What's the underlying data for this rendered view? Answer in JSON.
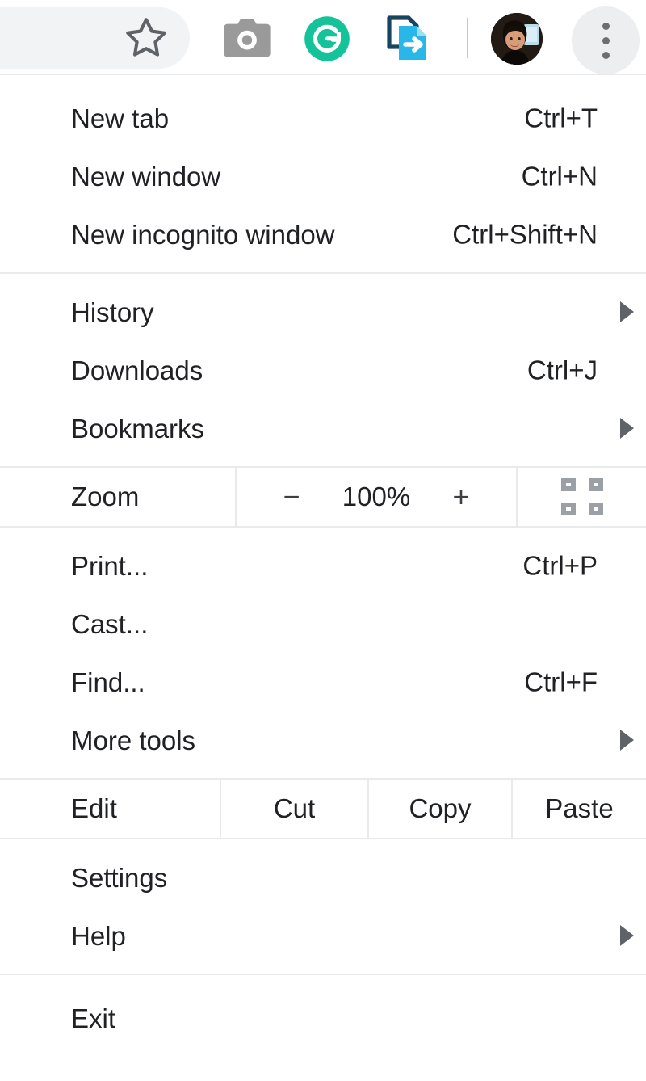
{
  "toolbar": {
    "bookmark_icon": "star-icon",
    "screenshot_icon": "camera-icon",
    "grammarly_icon": "grammarly-g-icon",
    "send_document_icon": "document-send-icon",
    "avatar_label": "profile-avatar",
    "menu_icon": "three-dot-menu-icon",
    "colors": {
      "omnibox_bg": "#f1f3f4",
      "grammarly_green": "#15c39a",
      "doc_cyan": "#29b6e8",
      "doc_navy": "#1b4965",
      "menu_btn_bg": "#eceef0"
    }
  },
  "menu": {
    "groups": [
      {
        "items": [
          {
            "label": "New tab",
            "shortcut": "Ctrl+T",
            "arrow": false
          },
          {
            "label": "New window",
            "shortcut": "Ctrl+N",
            "arrow": false
          },
          {
            "label": "New incognito window",
            "shortcut": "Ctrl+Shift+N",
            "arrow": false
          }
        ]
      },
      {
        "items": [
          {
            "label": "History",
            "shortcut": "",
            "arrow": true
          },
          {
            "label": "Downloads",
            "shortcut": "Ctrl+J",
            "arrow": false
          },
          {
            "label": "Bookmarks",
            "shortcut": "",
            "arrow": true
          }
        ]
      },
      {
        "items": [
          {
            "label": "Print...",
            "shortcut": "Ctrl+P",
            "arrow": false
          },
          {
            "label": "Cast...",
            "shortcut": "",
            "arrow": false
          },
          {
            "label": "Find...",
            "shortcut": "Ctrl+F",
            "arrow": false
          },
          {
            "label": "More tools",
            "shortcut": "",
            "arrow": true
          }
        ]
      },
      {
        "items": [
          {
            "label": "Settings",
            "shortcut": "",
            "arrow": false
          },
          {
            "label": "Help",
            "shortcut": "",
            "arrow": true
          }
        ]
      },
      {
        "items": [
          {
            "label": "Exit",
            "shortcut": "",
            "arrow": false
          }
        ]
      }
    ],
    "zoom": {
      "label": "Zoom",
      "minus": "−",
      "value": "100%",
      "plus": "+",
      "fullscreen_icon": "fullscreen-icon"
    },
    "edit": {
      "label": "Edit",
      "cut": "Cut",
      "copy": "Copy",
      "paste": "Paste"
    }
  }
}
